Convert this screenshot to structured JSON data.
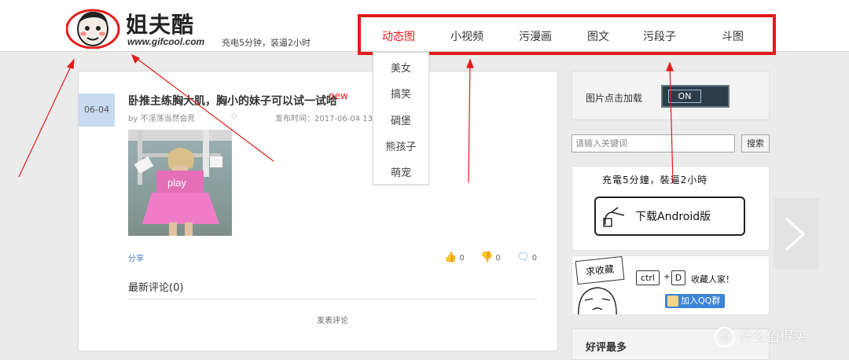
{
  "header": {
    "logo_text": "姐夫酷",
    "logo_url": "www.gifcool.com",
    "slogan": "充电5分钟，装逼2小时"
  },
  "nav": {
    "items": [
      "动态图",
      "小视频",
      "污漫画",
      "图文",
      "污段子",
      "斗图"
    ],
    "active_index": 0
  },
  "dropdown": {
    "items": [
      "美女",
      "搞笑",
      "碉堡",
      "熊孩子",
      "萌宠"
    ]
  },
  "post": {
    "date": "06-04",
    "title": "卧推主练胸大肌，胸小的妹子可以试一试哈",
    "new_tag": "new",
    "author": "by 不淫荡当然会死",
    "publish_time": "发布时间：2017-06-04 13:",
    "image_label": "play",
    "share": "分享",
    "likes": "0",
    "dislikes": "0",
    "comments_count": "0",
    "comments_heading": "最新评论(0)",
    "post_comment": "发表评论"
  },
  "sidebar": {
    "image_load_label": "图片点击加载",
    "toggle_state": "ON",
    "search_placeholder": "请输入关键词",
    "search_button": "搜索",
    "app_slogan": "充電5分鐘，裝逼2小時",
    "app_download": "下载Android版",
    "fav_sign": "求收藏",
    "fav_key1": "ctrl",
    "fav_plus": "+",
    "fav_key2": "D",
    "fav_text": "收藏人家！",
    "qq_button": "加入QQ群",
    "best_heading": "好评最多"
  },
  "watermark": {
    "badge": "值",
    "text": "什么值得买"
  },
  "colors": {
    "accent_red": "#e31c1c",
    "link_blue": "#4a7fc1",
    "date_badge": "#c7daf0",
    "toggle_bg": "#2e3b48"
  }
}
